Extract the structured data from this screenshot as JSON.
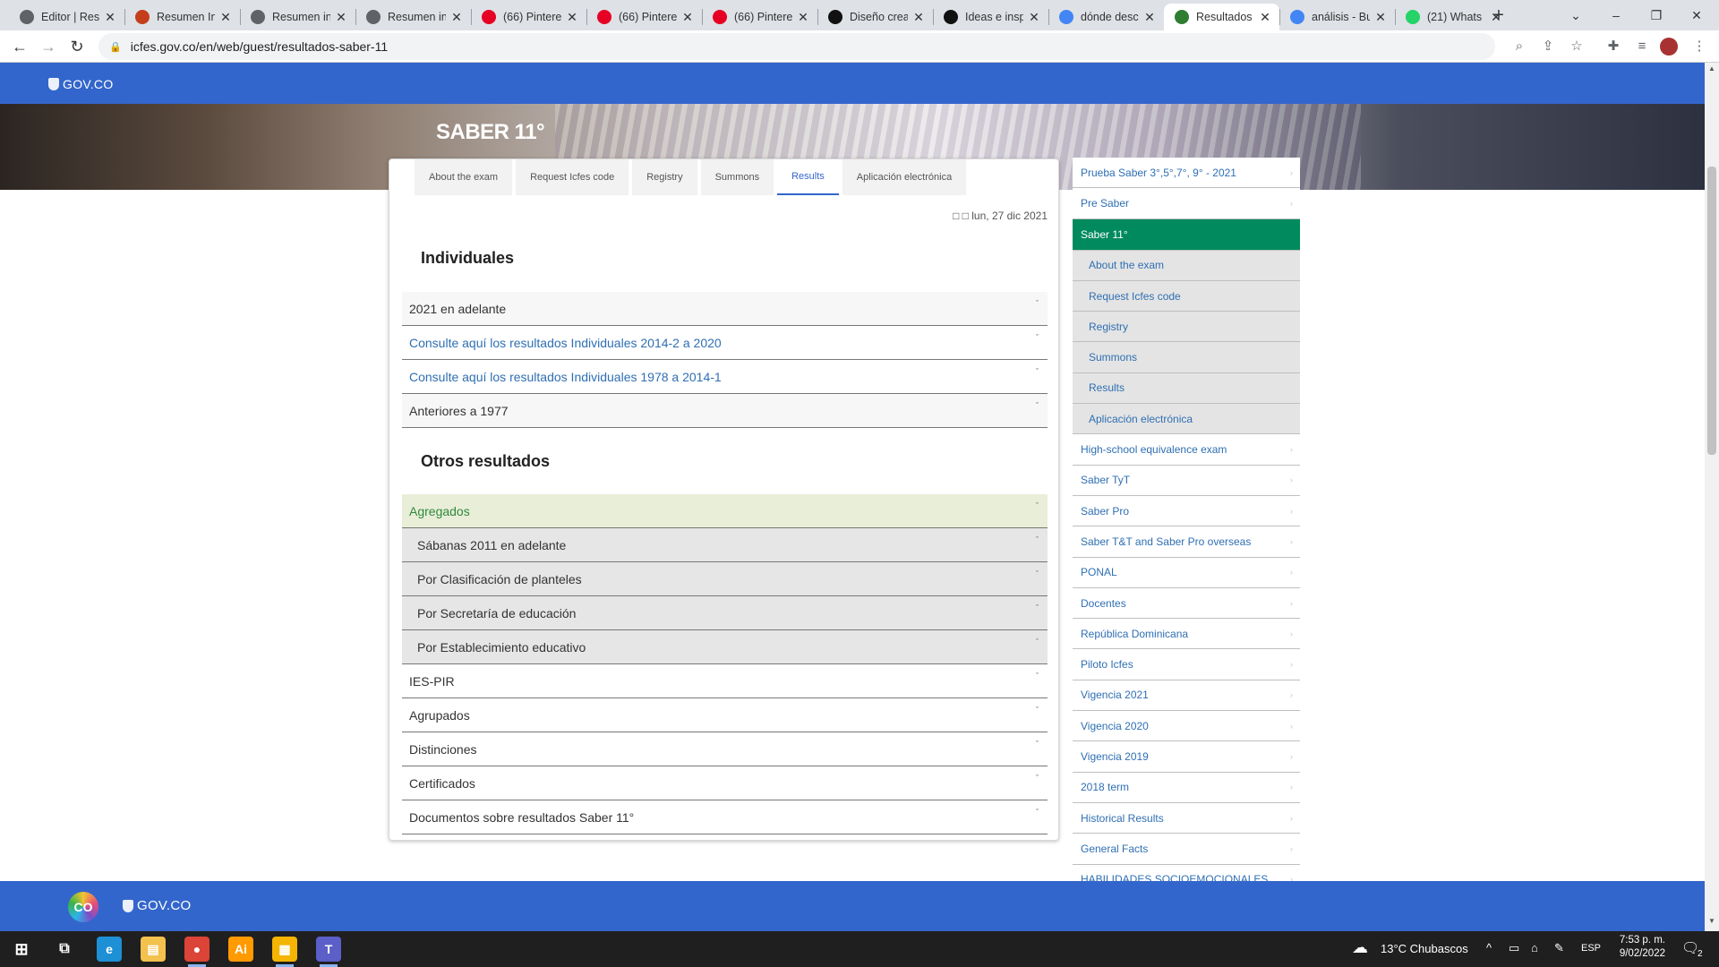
{
  "browser": {
    "tabs": [
      {
        "title": "Editor | Res",
        "icon": "chrome-icon",
        "color": "#5f6368"
      },
      {
        "title": "Resumen In",
        "icon": "powerpoint-icon",
        "color": "#c43e1c"
      },
      {
        "title": "Resumen in",
        "icon": "chrome-icon",
        "color": "#5f6368"
      },
      {
        "title": "Resumen in",
        "icon": "chrome-icon",
        "color": "#5f6368"
      },
      {
        "title": "(66) Pintere",
        "icon": "pinterest-icon",
        "color": "#e60023"
      },
      {
        "title": "(66) Pintere",
        "icon": "pinterest-icon",
        "color": "#e60023"
      },
      {
        "title": "(66) Pintere",
        "icon": "pinterest-icon",
        "color": "#e60023"
      },
      {
        "title": "Diseño crea",
        "icon": "domestika-icon",
        "color": "#111111"
      },
      {
        "title": "Ideas e insp",
        "icon": "domestika-icon",
        "color": "#111111"
      },
      {
        "title": "dónde desc",
        "icon": "google-icon",
        "color": "#4285f4"
      },
      {
        "title": "Resultados",
        "icon": "icfes-icon",
        "color": "#2e7d32"
      },
      {
        "title": "análisis - Bu",
        "icon": "google-icon",
        "color": "#4285f4"
      },
      {
        "title": "(21) Whats",
        "icon": "whatsapp-icon",
        "color": "#25d366"
      }
    ],
    "new_tab": "+",
    "url": "icfes.gov.co/en/web/guest/resultados-saber-11"
  },
  "page": {
    "gov_logo": "GOV.CO",
    "hero_title": "SABER 11°",
    "content_tabs": [
      {
        "label": "About the exam",
        "active": false
      },
      {
        "label": "Request Icfes code",
        "active": false
      },
      {
        "label": "Registry",
        "active": false
      },
      {
        "label": "Summons",
        "active": false
      },
      {
        "label": "Results",
        "active": true
      },
      {
        "label": "Aplicación electrónica",
        "active": false
      }
    ],
    "date": "□ □ lun, 27 dic 2021",
    "section1_title": "Individuales",
    "section1_items": [
      {
        "label": "2021 en adelante",
        "style": "default"
      },
      {
        "label": "Consulte aquí los resultados Individuales 2014-2 a 2020",
        "style": "link"
      },
      {
        "label": "Consulte aquí los resultados Individuales 1978 a 2014-1",
        "style": "link"
      },
      {
        "label": "Anteriores a 1977",
        "style": "default"
      }
    ],
    "section2_title": "Otros resultados",
    "section2_items": [
      {
        "label": "Agregados",
        "style": "highlight"
      },
      {
        "label": "Sábanas 2011 en adelante",
        "style": "sub"
      },
      {
        "label": "Por Clasificación de planteles",
        "style": "sub"
      },
      {
        "label": "Por Secretaría de educación",
        "style": "sub"
      },
      {
        "label": "Por Establecimiento educativo",
        "style": "sub"
      },
      {
        "label": "IES-PIR",
        "style": "plain"
      },
      {
        "label": "Agrupados",
        "style": "plain"
      },
      {
        "label": "Distinciones",
        "style": "plain"
      },
      {
        "label": "Certificados",
        "style": "plain"
      },
      {
        "label": "Documentos sobre resultados Saber 11°",
        "style": "plain"
      }
    ],
    "chevron": "ˇ",
    "sidebar": [
      {
        "label": "Prueba Saber 3°,5°,7°, 9° - 2021",
        "style": "default"
      },
      {
        "label": "Pre Saber",
        "style": "default"
      },
      {
        "label": "Saber 11°",
        "style": "active"
      },
      {
        "label": "About the exam",
        "style": "child"
      },
      {
        "label": "Request Icfes code",
        "style": "child"
      },
      {
        "label": "Registry",
        "style": "child"
      },
      {
        "label": "Summons",
        "style": "child"
      },
      {
        "label": "Results",
        "style": "child"
      },
      {
        "label": "Aplicación electrónica",
        "style": "child"
      },
      {
        "label": "High-school equivalence exam",
        "style": "default"
      },
      {
        "label": "Saber TyT",
        "style": "default"
      },
      {
        "label": "Saber Pro",
        "style": "default"
      },
      {
        "label": "Saber T&T and Saber Pro overseas",
        "style": "default"
      },
      {
        "label": "PONAL",
        "style": "default"
      },
      {
        "label": "Docentes",
        "style": "default"
      },
      {
        "label": "República Dominicana",
        "style": "default"
      },
      {
        "label": "Piloto Icfes",
        "style": "default"
      },
      {
        "label": "Vigencia 2021",
        "style": "default"
      },
      {
        "label": "Vigencia 2020",
        "style": "default"
      },
      {
        "label": "Vigencia 2019",
        "style": "default"
      },
      {
        "label": "2018 term",
        "style": "default"
      },
      {
        "label": "Historical Results",
        "style": "default"
      },
      {
        "label": "General Facts",
        "style": "default"
      },
      {
        "label": "HABILIDADES SOCIOEMOCIONALES",
        "style": "default"
      }
    ],
    "footer_co": "CO",
    "footer_logo": "GOV.CO"
  },
  "taskbar": {
    "apps": [
      {
        "name": "edge-icon",
        "label": "e",
        "color": "#1e90d6"
      },
      {
        "name": "file-explorer-icon",
        "label": "▤",
        "color": "#f2c14e"
      },
      {
        "name": "chrome-icon",
        "label": "●",
        "color": "#db4437"
      },
      {
        "name": "illustrator-icon",
        "label": "Ai",
        "color": "#ff9a00"
      },
      {
        "name": "files-icon",
        "label": "▦",
        "color": "#f4b400"
      },
      {
        "name": "teams-icon",
        "label": "T",
        "color": "#5b5fc7"
      }
    ],
    "weather": "13°C  Chubascos",
    "lang": "ESP",
    "time": "7:53 p. m.",
    "date": "9/02/2022",
    "notifications": "2"
  }
}
